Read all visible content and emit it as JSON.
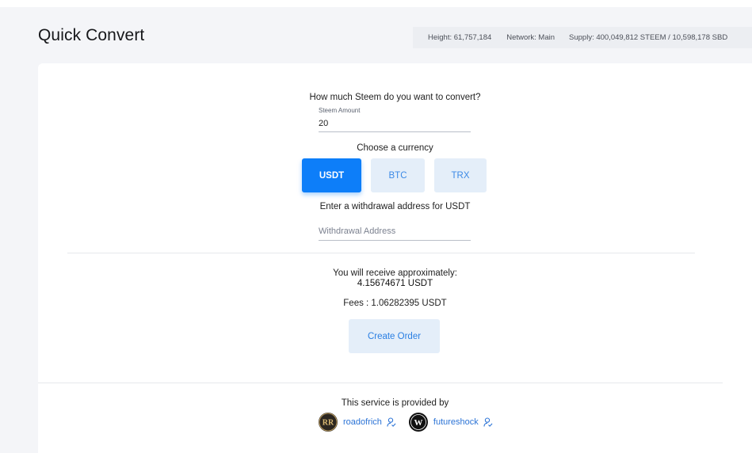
{
  "header": {
    "title": "Quick Convert",
    "stats": {
      "height": "Height: 61,757,184",
      "network": "Network: Main",
      "supply": "Supply: 400,049,812 STEEM / 10,598,178 SBD"
    }
  },
  "form": {
    "question": "How much Steem do you want to convert?",
    "amount_caption": "Steem Amount",
    "amount_value": "20",
    "currency_prompt": "Choose a currency",
    "currencies": [
      "USDT",
      "BTC",
      "TRX"
    ],
    "selected_currency": "USDT",
    "withdraw_prompt": "Enter a withdrawal address for USDT",
    "withdraw_placeholder": "Withdrawal Address",
    "withdraw_value": ""
  },
  "result": {
    "receive_label": "You will receive approximately:",
    "receive_value": "4.15674671 USDT",
    "fees": "Fees : 1.06282395 USDT",
    "create_button": "Create Order"
  },
  "footer": {
    "provided_by": "This service is provided by",
    "providers": [
      {
        "name": "roadofrich",
        "avatar_text": "RR",
        "icon": "user-icon"
      },
      {
        "name": "futureshock",
        "avatar_text": "W",
        "icon": "user-icon"
      }
    ]
  },
  "colors": {
    "accent": "#0d7ef9",
    "secondary_button_bg": "#e4eef9",
    "link": "#2b73d6",
    "background": "#f4f5f8"
  }
}
